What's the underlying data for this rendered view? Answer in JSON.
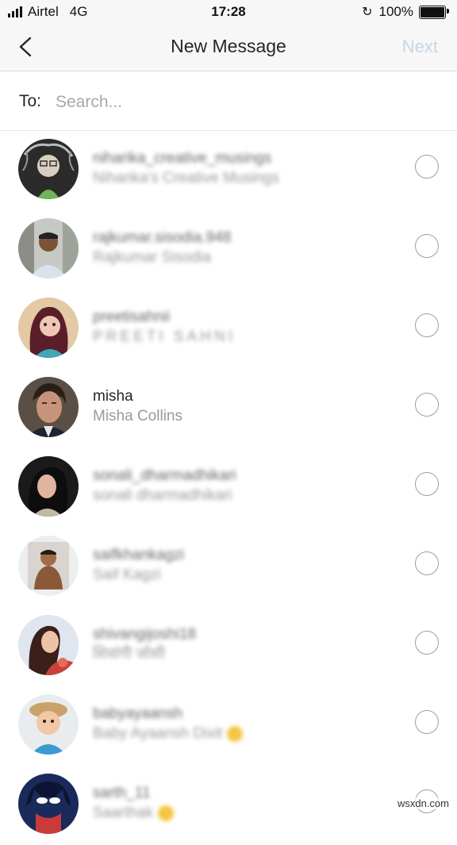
{
  "status_bar": {
    "carrier": "Airtel",
    "network": "4G",
    "time": "17:28",
    "battery": "100%"
  },
  "nav": {
    "title": "New Message",
    "next_label": "Next",
    "next_color": "#c7d5e4"
  },
  "to_row": {
    "label": "To:",
    "search_placeholder": "Search...",
    "search_value": ""
  },
  "contacts": [
    {
      "username": "niharika_creative_musings",
      "full_name": "Niharika's Creative Musings",
      "blurred": true
    },
    {
      "username": "rajkumar.sisodia.948",
      "full_name": "Rajkumar Sisodia",
      "blurred": true
    },
    {
      "username": "preetisahnii",
      "full_name": "PREETI SAHNI",
      "blurred": true
    },
    {
      "username": "misha",
      "full_name": "Misha Collins",
      "blurred": false
    },
    {
      "username": "sonali_dharmadhikari",
      "full_name": "sonali dharmadhikari",
      "blurred": true
    },
    {
      "username": "saifkhankagzi",
      "full_name": "Saif Kagzi",
      "blurred": true
    },
    {
      "username": "shivangijoshi18",
      "full_name": "शिवांगी जोशी",
      "blurred": true
    },
    {
      "username": "babyayaansh",
      "full_name": "Baby Ayaansh Dixit",
      "blurred": true
    },
    {
      "username": "sarth_11",
      "full_name": "Saarthak",
      "blurred": true
    }
  ],
  "watermark": "wsxdn.com"
}
